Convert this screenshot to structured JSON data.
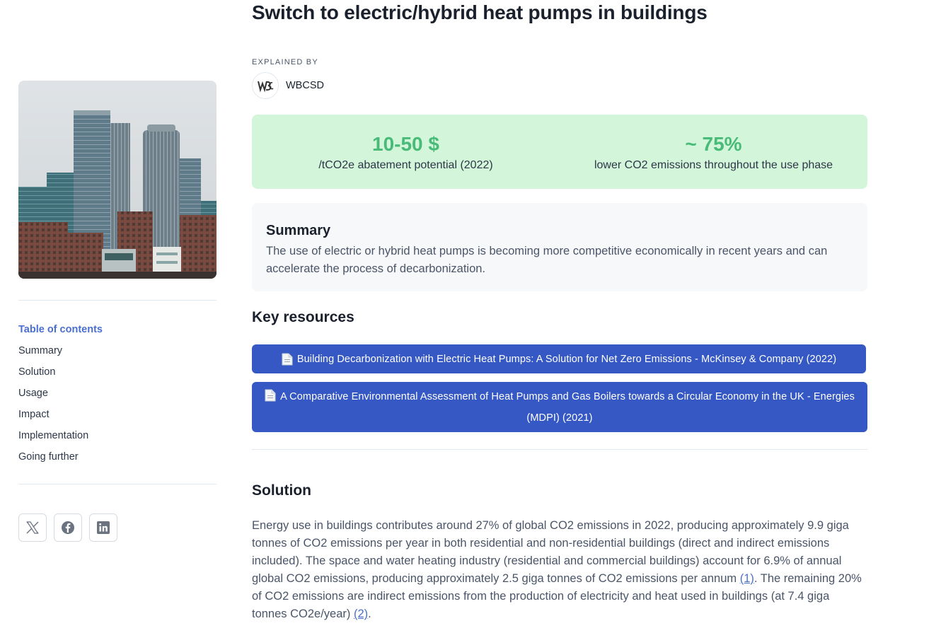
{
  "page": {
    "title": "Switch to electric/hybrid heat pumps in buildings",
    "explained_by_label": "EXPLAINED BY",
    "author": {
      "name": "WBCSD",
      "logo_icon": "wbcsd-logo"
    }
  },
  "sidebar": {
    "toc_title": "Table of contents",
    "toc": [
      "Summary",
      "Solution",
      "Usage",
      "Impact",
      "Implementation",
      "Going further"
    ],
    "share": [
      {
        "icon": "x-twitter-icon"
      },
      {
        "icon": "facebook-icon"
      },
      {
        "icon": "linkedin-icon"
      }
    ]
  },
  "stats": [
    {
      "value": "10-50 $",
      "label": "/tCO2e abatement potential (2022)"
    },
    {
      "value": "~ 75%",
      "label": "lower CO2 emissions throughout the use phase"
    }
  ],
  "summary": {
    "heading": "Summary",
    "text": "The use of electric or hybrid heat pumps is becoming more competitive economically in recent years and can accelerate the process of decarbonization."
  },
  "key_resources": {
    "heading": "Key resources",
    "items": [
      "Building Decarbonization with Electric Heat Pumps: A Solution for Net Zero Emissions - McKinsey & Company (2022)",
      "A Comparative Environmental Assessment of Heat Pumps and Gas Boilers towards a Circular Economy in the UK - Energies (MDPI) (2021)"
    ]
  },
  "solution": {
    "heading": "Solution",
    "p1": "Energy use in buildings contributes around 27% of global CO2 emissions in 2022, producing approximately 9.9 giga tonnes of CO2 emissions per year in both residential and non-residential buildings (direct and indirect emissions included). The space and water heating industry (residential and commercial buildings) account for 6.9% of annual global CO2 emissions, producing approximately 2.5 giga tonnes of CO2 emissions per annum ",
    "ref1": "(1)",
    "p2": ". The remaining 20% of CO2 emissions are indirect emissions from the production of electricity and heat used in buildings (at 7.4 giga tonnes CO2e/year) ",
    "ref2": "(2)",
    "p3": "."
  },
  "colors": {
    "accent_blue": "#3558c4",
    "toc_active": "#4a6fd0",
    "stat_green": "#48bb78",
    "stat_bg": "#d3f5da"
  }
}
